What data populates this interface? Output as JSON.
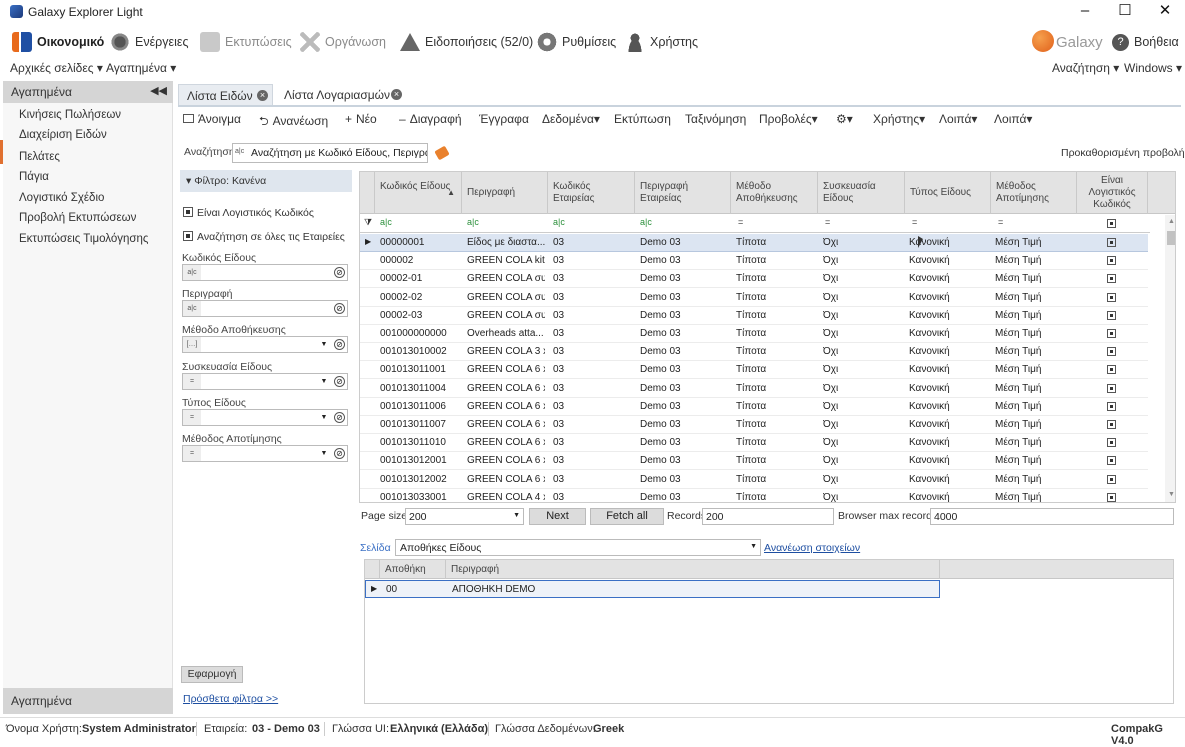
{
  "app": {
    "title": "Galaxy Explorer Light"
  },
  "menu": [
    {
      "label": "Οικονομικό",
      "enabled": true,
      "icon": "chart-icon",
      "bold": true
    },
    {
      "label": "Ενέργειες",
      "enabled": true,
      "icon": "gears-icon"
    },
    {
      "label": "Εκτυπώσεις",
      "enabled": false,
      "icon": "print-icon"
    },
    {
      "label": "Οργάνωση",
      "enabled": false,
      "icon": "tools-icon"
    },
    {
      "label": "Ειδοποιήσεις (52/0)",
      "enabled": true,
      "icon": "warning-icon"
    },
    {
      "label": "Ρυθμίσεις",
      "enabled": true,
      "icon": "settings-icon"
    },
    {
      "label": "Χρήστης",
      "enabled": true,
      "icon": "user-icon"
    }
  ],
  "brand": {
    "text": "Galaxy",
    "help": "Βοήθεια"
  },
  "submenu": {
    "home": "Αρχικές σελίδες",
    "favorites": "Αγαπημένα",
    "search": "Αναζήτηση",
    "windows": "Windows"
  },
  "sidebar": {
    "header": "Αγαπημένα",
    "footer": "Αγαπημένα",
    "items": [
      "Κινήσεις Πωλήσεων",
      "Διαχείριση Ειδών",
      "Πελάτες",
      "Πάγια",
      "Λογιστικό Σχέδιο",
      "Προβολή Εκτυπώσεων",
      "Εκτυπώσεις Τιμολόγησης"
    ]
  },
  "tabs": [
    {
      "label": "Λίστα Ειδών"
    },
    {
      "label": "Λίστα Λογαριασμών"
    }
  ],
  "toolbar": {
    "open": "Άνοιγμα",
    "refresh": "Ανανέωση",
    "new": "Νέο",
    "delete": "Διαγραφή",
    "documents": "Έγγραφα",
    "data": "Δεδομένα",
    "print": "Εκτύπωση",
    "sort": "Ταξινόμηση",
    "views": "Προβολές",
    "user": "Χρήστης",
    "other1": "Λοιπά",
    "other2": "Λοιπά"
  },
  "search": {
    "label": "Αναζήτηση",
    "value": "Αναζήτηση με Κωδικό Είδους, Περιγραφή",
    "default_view": "Προκαθορισμένη προβολή"
  },
  "filters": {
    "header": "Φίλτρο: Κανένα",
    "check1": "Είναι Λογιστικός Κωδικός",
    "check2": "Αναζήτηση σε όλες τις Εταιρείες",
    "f1": "Κωδικός Είδους",
    "f2": "Περιγραφή",
    "f3": "Μέθοδο Αποθήκευσης",
    "f4": "Συσκευασία Είδους",
    "f5": "Τύπος Είδους",
    "f6": "Μέθοδος Αποτίμησης",
    "apply": "Εφαρμογή",
    "more": "Πρόσθετα φίλτρα >>"
  },
  "grid": {
    "headers": [
      "Κωδικός Είδους",
      "Περιγραφή",
      "Κωδικός Εταιρείας",
      "Περιγραφή Εταιρείας",
      "Μέθοδο Αποθήκευσης",
      "Συσκευασία Είδους",
      "Τύπος Είδους",
      "Μέθοδος Αποτίμησης",
      "Είναι Λογιστικός Κωδικός"
    ],
    "rows": [
      [
        "00000001",
        "Είδος με διαστα...",
        "03",
        "Demo 03",
        "Τίποτα",
        "Όχι",
        "Κανονική",
        "Μέση Τιμή"
      ],
      [
        "000002",
        "GREEN COLA kit ...",
        "03",
        "Demo 03",
        "Τίποτα",
        "Όχι",
        "Κανονική",
        "Μέση Τιμή"
      ],
      [
        "00002-01",
        "GREEN COLA συ...",
        "03",
        "Demo 03",
        "Τίποτα",
        "Όχι",
        "Κανονική",
        "Μέση Τιμή"
      ],
      [
        "00002-02",
        "GREEN COLA συ...",
        "03",
        "Demo 03",
        "Τίποτα",
        "Όχι",
        "Κανονική",
        "Μέση Τιμή"
      ],
      [
        "00002-03",
        "GREEN COLA συ...",
        "03",
        "Demo 03",
        "Τίποτα",
        "Όχι",
        "Κανονική",
        "Μέση Τιμή"
      ],
      [
        "001000000000",
        "Overheads atta...",
        "03",
        "Demo 03",
        "Τίποτα",
        "Όχι",
        "Κανονική",
        "Μέση Τιμή"
      ],
      [
        "001013010002",
        "GREEN COLA 3 x...",
        "03",
        "Demo 03",
        "Τίποτα",
        "Όχι",
        "Κανονική",
        "Μέση Τιμή"
      ],
      [
        "001013011001",
        "GREEN COLA 6 x...",
        "03",
        "Demo 03",
        "Τίποτα",
        "Όχι",
        "Κανονική",
        "Μέση Τιμή"
      ],
      [
        "001013011004",
        "GREEN COLA 6 x...",
        "03",
        "Demo 03",
        "Τίποτα",
        "Όχι",
        "Κανονική",
        "Μέση Τιμή"
      ],
      [
        "001013011006",
        "GREEN COLA 6 x...",
        "03",
        "Demo 03",
        "Τίποτα",
        "Όχι",
        "Κανονική",
        "Μέση Τιμή"
      ],
      [
        "001013011007",
        "GREEN COLA 6 x...",
        "03",
        "Demo 03",
        "Τίποτα",
        "Όχι",
        "Κανονική",
        "Μέση Τιμή"
      ],
      [
        "001013011010",
        "GREEN COLA 6 x...",
        "03",
        "Demo 03",
        "Τίποτα",
        "Όχι",
        "Κανονική",
        "Μέση Τιμή"
      ],
      [
        "001013012001",
        "GREEN COLA 6 x...",
        "03",
        "Demo 03",
        "Τίποτα",
        "Όχι",
        "Κανονική",
        "Μέση Τιμή"
      ],
      [
        "001013012002",
        "GREEN COLA 6 x...",
        "03",
        "Demo 03",
        "Τίποτα",
        "Όχι",
        "Κανονική",
        "Μέση Τιμή"
      ],
      [
        "001013033001",
        "GREEN COLA 4 x ...",
        "03",
        "Demo 03",
        "Τίποτα",
        "Όχι",
        "Κανονική",
        "Μέση Τιμή"
      ]
    ]
  },
  "paging": {
    "page_size_label": "Page size",
    "page_size": "200",
    "next": "Next",
    "fetch_all": "Fetch all",
    "records_label": "Records",
    "records": "200",
    "max_label": "Browser max records",
    "max": "4000"
  },
  "detail": {
    "page_label": "Σελίδα",
    "page_value": "Αποθήκες Είδους",
    "refresh_link": "Ανανέωση στοιχείων",
    "headers": [
      "Αποθήκη",
      "Περιγραφή"
    ],
    "rows": [
      [
        "00",
        "ΑΠΟΘΗΚΗ DEMO"
      ]
    ]
  },
  "status": {
    "user_label": "Όνομα Χρήστη:",
    "user": "System Administrator",
    "company_label": "Εταιρεία:",
    "company": "03 - Demo 03",
    "ui_lang_label": "Γλώσσα UI:",
    "ui_lang": "Ελληνικά (Ελλάδα)",
    "data_lang_label": "Γλώσσα Δεδομένων:",
    "data_lang": "Greek",
    "version": "CompakG V4.0"
  }
}
